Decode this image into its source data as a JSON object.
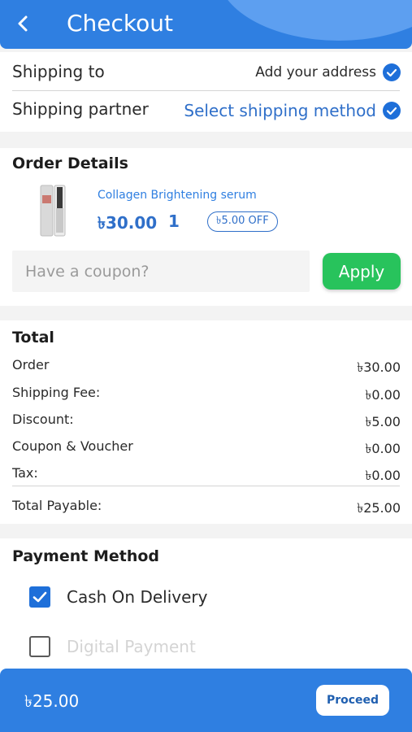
{
  "header": {
    "title": "Checkout",
    "back_icon": "chevron-left-icon",
    "color": "#2f7fe1"
  },
  "shipping": {
    "to_label": "Shipping to",
    "to_value": "Add your address",
    "partner_label": "Shipping partner",
    "partner_value": "Select shipping method",
    "edit_icon": "edit-check-icon"
  },
  "order_details": {
    "title": "Order Details",
    "product": {
      "name": "Collagen Brightening serum",
      "price": "৳30.00",
      "quantity": "1",
      "discount_badge": "৳5.00 OFF"
    },
    "coupon": {
      "placeholder": "Have a coupon?",
      "apply_label": "Apply",
      "apply_color": "#28c35c"
    }
  },
  "total": {
    "title": "Total",
    "rows": [
      {
        "label": "Order",
        "value": "৳30.00"
      },
      {
        "label": "Shipping Fee:",
        "value": "৳0.00"
      },
      {
        "label": "Discount:",
        "value": "৳5.00"
      },
      {
        "label": "Coupon & Voucher",
        "value": "৳0.00"
      },
      {
        "label": "Tax:",
        "value": "৳0.00"
      }
    ],
    "payable_label": "Total Payable:",
    "payable_value": "৳25.00"
  },
  "payment": {
    "title": "Payment Method",
    "options": [
      {
        "label": "Cash On Delivery",
        "checked": true
      },
      {
        "label": "Digital Payment",
        "checked": false
      }
    ]
  },
  "footer": {
    "total": "৳25.00",
    "proceed_label": "Proceed"
  }
}
